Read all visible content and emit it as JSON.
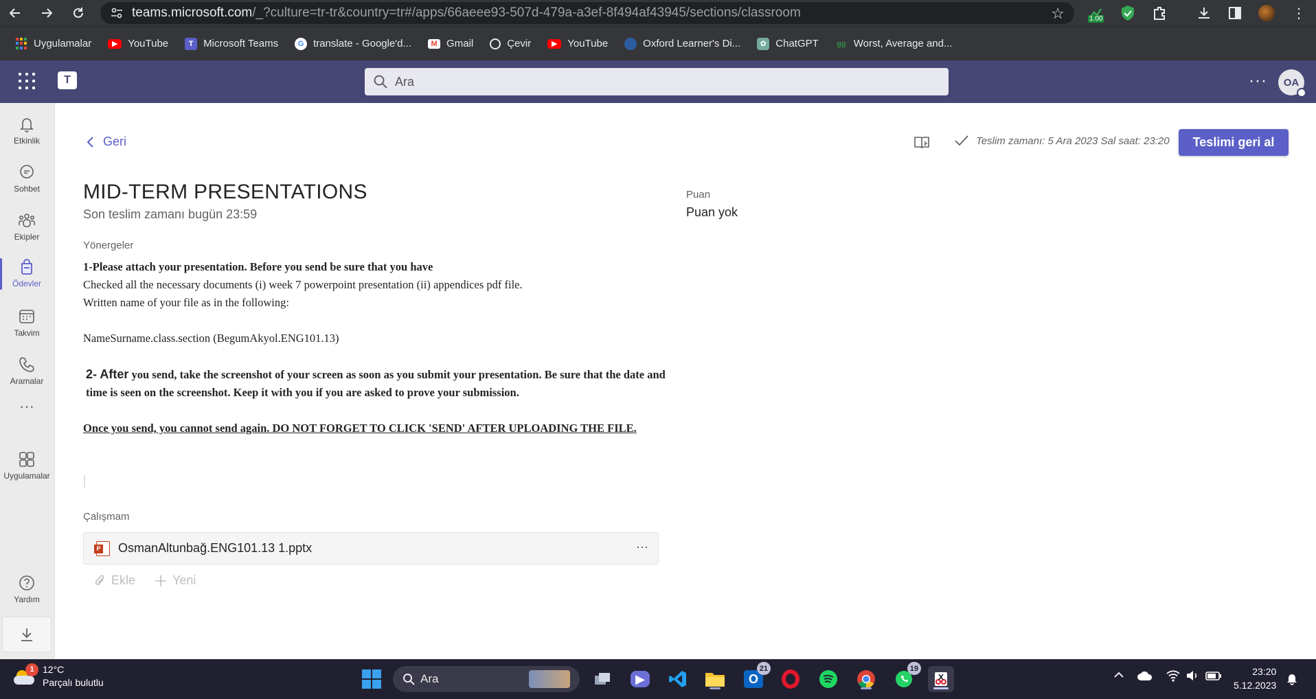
{
  "browser": {
    "url_host": "teams.microsoft.com",
    "url_path": "/_?culture=tr-tr&country=tr#/apps/66aeee93-507d-479a-a3ef-8f494af43945/sections/classroom",
    "extension_badge": "1.00"
  },
  "bookmarks": [
    {
      "label": "Uygulamalar",
      "icon": "apps-grid-icon",
      "color": "#e8eaed"
    },
    {
      "label": "YouTube",
      "icon": "youtube-icon",
      "color": "#ff0000"
    },
    {
      "label": "Microsoft Teams",
      "icon": "teams-icon",
      "color": "#5b5fc7"
    },
    {
      "label": "translate - Google'd...",
      "icon": "google-icon",
      "color": "#4285f4"
    },
    {
      "label": "Gmail",
      "icon": "gmail-icon",
      "color": "#ea4335"
    },
    {
      "label": "Çevir",
      "icon": "translate-icon",
      "color": "#e8eaed"
    },
    {
      "label": "YouTube",
      "icon": "youtube-icon",
      "color": "#ff0000"
    },
    {
      "label": "Oxford Learner's Di...",
      "icon": "oxford-icon",
      "color": "#2d5da1"
    },
    {
      "label": "ChatGPT",
      "icon": "chatgpt-icon",
      "color": "#74aa9c"
    },
    {
      "label": "Worst, Average and...",
      "icon": "gfg-icon",
      "color": "#2f8d46"
    }
  ],
  "teams": {
    "search_placeholder": "Ara",
    "avatar_initials": "OA",
    "accent": "#5b5fc7",
    "header_color": "#464775"
  },
  "rail": [
    {
      "label": "Etkinlik",
      "icon": "bell-icon"
    },
    {
      "label": "Sohbet",
      "icon": "chat-icon"
    },
    {
      "label": "Ekipler",
      "icon": "teams-people-icon"
    },
    {
      "label": "Ödevler",
      "icon": "assignments-icon",
      "active": true
    },
    {
      "label": "Takvim",
      "icon": "calendar-icon"
    },
    {
      "label": "Aramalar",
      "icon": "phone-icon"
    },
    {
      "label": "Uygulamalar",
      "icon": "apps-icon"
    },
    {
      "label": "Yardım",
      "icon": "help-icon"
    }
  ],
  "assignment": {
    "back_label": "Geri",
    "title": "MID-TERM PRESENTATIONS",
    "due": "Son teslim zamanı bugün 23:59",
    "instructions_label": "Yönergeler",
    "instr_line1": "1-Please attach your presentation. Before you send be sure that you have",
    "instr_line2": "Checked all the necessary documents (i) week 7 powerpoint presentation (ii) appendices pdf file.",
    "instr_line3": "Written name of your file as in the following:",
    "instr_line4": "NameSurname.class.section (BegumAkyol.ENG101.13)",
    "instr_2_lead": "2- After",
    "instr_2_rest": " you send, take the screenshot of your screen as soon as you submit your presentation. Be sure that the date and time is seen on the screenshot. Keep it with you if you are asked to prove your submission.",
    "instr_warning": "Once you send, you cannot send again. DO NOT FORGET TO CLICK 'SEND' AFTER UPLOADING THE FILE.",
    "work_label": "Çalışmam",
    "file_name": "OsmanAltunbağ.ENG101.13 1.pptx",
    "attach_label": "Ekle",
    "new_label": "Yeni",
    "points_label": "Puan",
    "points_value": "Puan yok",
    "turned_in": "Teslim zamanı: 5 Ara 2023 Sal saat: 23:20",
    "undo_button": "Teslimi geri al"
  },
  "taskbar": {
    "weather_badge": "1",
    "temperature": "12°C",
    "weather_text": "Parçalı bulutlu",
    "search_label": "Ara",
    "outlook_badge": "21",
    "whatsapp_badge": "19",
    "time": "23:20",
    "date": "5.12.2023"
  }
}
